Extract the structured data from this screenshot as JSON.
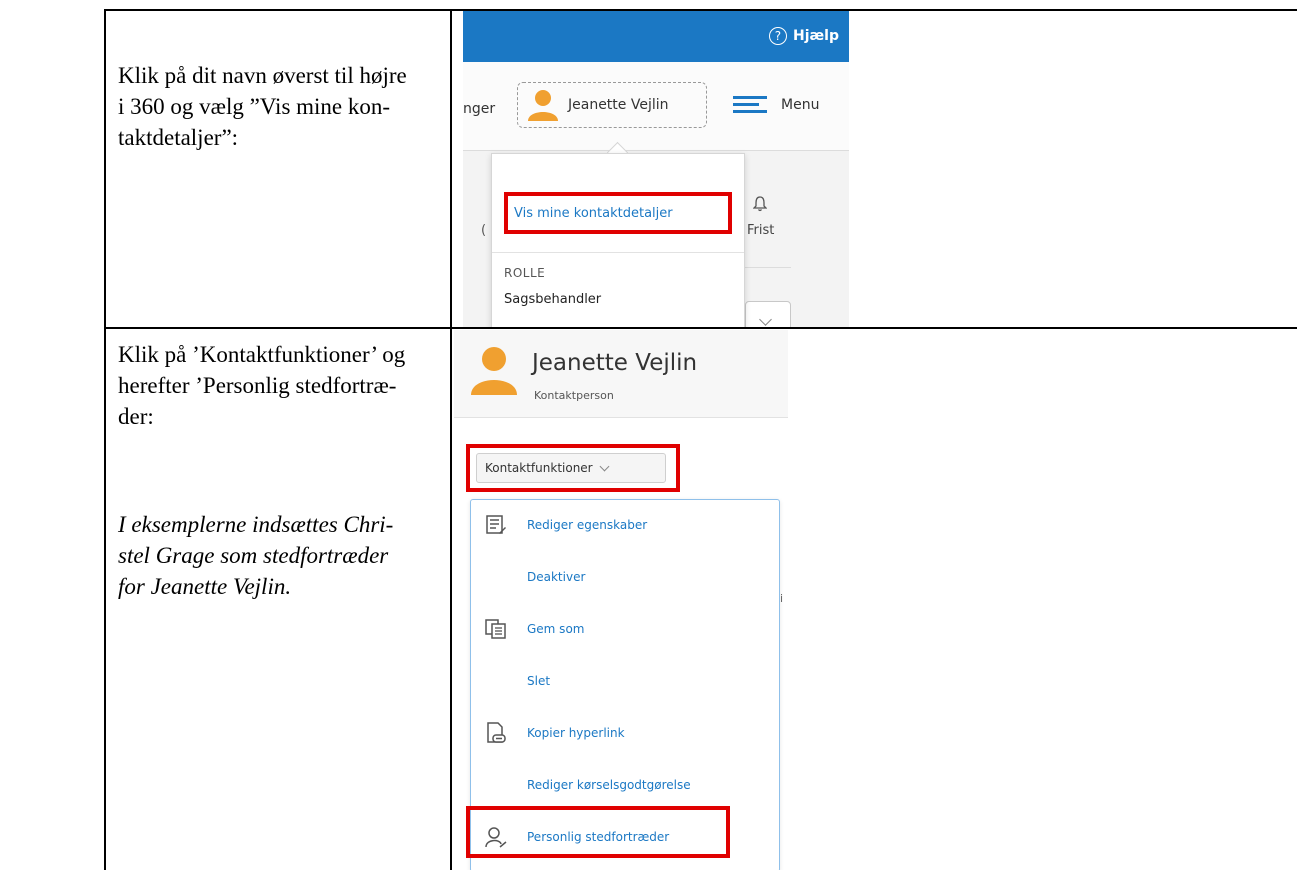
{
  "row1": {
    "instruction": "Klik på dit navn øverst til højre i 360 og vælg ”Vis mine kon-taktdetaljer”:",
    "lines": [
      "Klik på dit navn øverst til højre",
      "i 360 og vælg ”Vis mine kon-",
      "taktdetaljer”:"
    ]
  },
  "row2": {
    "lines": [
      "Klik på ’Kontaktfunktioner’ og",
      "herefter ’Personlig stedfortræ-",
      "der:"
    ],
    "note_lines": [
      "I eksemplerne indsættes Chri-",
      "stel Grage som stedfortræder",
      "for Jeanette Vejlin."
    ]
  },
  "screenshot1": {
    "help_label": "Hjælp",
    "partial_left": "nger",
    "user_name": "Jeanette Vejlin",
    "menu_label": "Menu",
    "dropdown": {
      "link": "Vis mine kontaktdetaljer",
      "role_heading": "ROLLE",
      "role_value": "Sagsbehandler"
    },
    "side_label": "Frist",
    "partial_char": "("
  },
  "screenshot2": {
    "person_name": "Jeanette Vejlin",
    "person_type": "Kontaktperson",
    "button_label": "Kontaktfunktioner",
    "partial_right": "i",
    "menu_items": [
      {
        "label": "Rediger egenskaber",
        "icon": "edit-properties-icon"
      },
      {
        "label": "Deaktiver",
        "icon": ""
      },
      {
        "label": "Gem som",
        "icon": "save-as-icon"
      },
      {
        "label": "Slet",
        "icon": ""
      },
      {
        "label": "Kopier hyperlink",
        "icon": "copy-link-icon"
      },
      {
        "label": "Rediger kørselsgodtgørelse",
        "icon": ""
      },
      {
        "label": "Personlig stedfortræder",
        "icon": "person-substitute-icon"
      }
    ]
  },
  "colors": {
    "highlight": "#e00000",
    "brand_blue": "#1b78c4",
    "avatar": "#f0a030"
  }
}
